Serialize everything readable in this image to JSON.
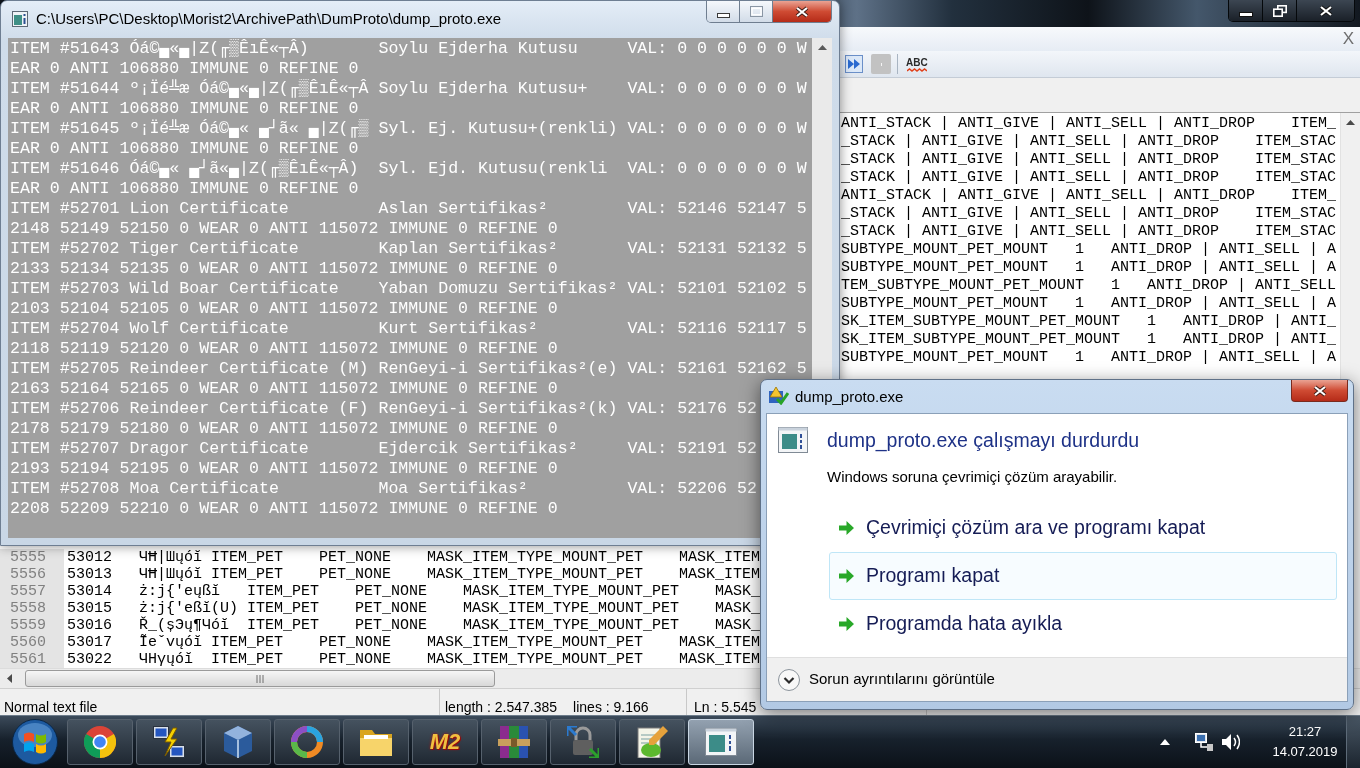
{
  "editor_window": {
    "close_document_label": "X",
    "spellcheck_label": "ABC",
    "visible_text": [
      "ANTI_STACK | ANTI_GIVE | ANTI_SELL | ANTI_DROP    ITEM_",
      "_STACK | ANTI_GIVE | ANTI_SELL | ANTI_DROP    ITEM_STAC",
      "_STACK | ANTI_GIVE | ANTI_SELL | ANTI_DROP    ITEM_STAC",
      "_STACK | ANTI_GIVE | ANTI_SELL | ANTI_DROP    ITEM_STAC",
      "ANTI_STACK | ANTI_GIVE | ANTI_SELL | ANTI_DROP    ITEM_",
      "_STACK | ANTI_GIVE | ANTI_SELL | ANTI_DROP    ITEM_STAC",
      "_STACK | ANTI_GIVE | ANTI_SELL | ANTI_DROP    ITEM_STAC",
      "SUBTYPE_MOUNT_PET_MOUNT   1   ANTI_DROP | ANTI_SELL | A",
      "SUBTYPE_MOUNT_PET_MOUNT   1   ANTI_DROP | ANTI_SELL | A",
      "TEM_SUBTYPE_MOUNT_PET_MOUNT   1   ANTI_DROP | ANTI_SELL",
      "SUBTYPE_MOUNT_PET_MOUNT   1   ANTI_DROP | ANTI_SELL | A",
      "SK_ITEM_SUBTYPE_MOUNT_PET_MOUNT   1   ANTI_DROP | ANTI_",
      "SK_ITEM_SUBTYPE_MOUNT_PET_MOUNT   1   ANTI_DROP | ANTI_",
      "SUBTYPE_MOUNT_PET_MOUNT   1   ANTI_DROP | ANTI_SELL | A"
    ],
    "rows": [
      {
        "line_number": "5555",
        "columns": [
          "53012",
          "ЧĦ|Шųóĭ",
          "ITEM_PET",
          "PET_NONE",
          "MASK_ITEM_TYPE_MOUNT_PET",
          "MASK_ITEM"
        ]
      },
      {
        "line_number": "5556",
        "columns": [
          "53013",
          "ЧĦ|Шųóĭ",
          "ITEM_PET",
          "PET_NONE",
          "MASK_ITEM_TYPE_MOUNT_PET",
          "MASK_ITEM"
        ]
      },
      {
        "line_number": "5557",
        "columns": [
          "53014",
          "ż:j{'eųßĭ",
          "ITEM_PET",
          "PET_NONE",
          "MASK_ITEM_TYPE_MOUNT_PET",
          "MASK_"
        ]
      },
      {
        "line_number": "5558",
        "columns": [
          "53015",
          "ż:j{'eßĭ(U)",
          "ITEM_PET",
          "PET_NONE",
          "MASK_ITEM_TYPE_MOUNT_PET",
          "MASK_"
        ]
      },
      {
        "line_number": "5559",
        "columns": [
          "53016",
          "Ř_(șЭų¶Чóĭ",
          "ITEM_PET",
          "PET_NONE",
          "MASK_ITEM_TYPE_MOUNT_PET",
          "MASK_"
        ]
      },
      {
        "line_number": "5560",
        "columns": [
          "53017",
          "Ĩeˇvųóĭ",
          "ITEM_PET",
          "PET_NONE",
          "MASK_ITEM_TYPE_MOUNT_PET",
          "MASK_ITEM"
        ]
      },
      {
        "line_number": "5561",
        "columns": [
          "53022",
          "ЧHγųóĭ",
          "ITEM_PET",
          "PET_NONE",
          "MASK_ITEM_TYPE_MOUNT_PET",
          "MASK_ITEM"
        ]
      }
    ],
    "status_bar": [
      [
        "Normal text file"
      ],
      [
        "length : 2.547.385",
        "lines : 9.166"
      ],
      [
        "Ln : 5.545"
      ]
    ]
  },
  "console_window": {
    "title": "C:\\Users\\PC\\Desktop\\Morist2\\ArchivePath\\DumProto\\dump_proto.exe",
    "lines": [
      "ITEM #51643 Óá©▄«▄|Z(╓▒ÊıÊ«┬Â)       Soylu Ejderha Kutusu     VAL: 0 0 0 0 0 0 W",
      "EAR 0 ANTI 106880 IMMUNE 0 REFINE 0",
      "ITEM #51644 º¡Ïé╩æ Óá©▄«▄|Z(╓▒ÊıÊ«┬Â Soylu Ejderha Kutusu+    VAL: 0 0 0 0 0 0 W",
      "EAR 0 ANTI 106880 IMMUNE 0 REFINE 0",
      "ITEM #51645 º¡Ïé╩æ Óá©▄« ▄┘ã« ▄|Z(╓▒ Syl. Ej. Kutusu+(renkli) VAL: 0 0 0 0 0 0 W",
      "EAR 0 ANTI 106880 IMMUNE 0 REFINE 0",
      "ITEM #51646 Óá©▄« ▄┘ã«▄|Z(╓▒ÊıÊ«┬Â)  Syl. Ejd. Kutusu(renkli  VAL: 0 0 0 0 0 0 W",
      "EAR 0 ANTI 106880 IMMUNE 0 REFINE 0",
      "ITEM #52701 Lion Certificate         Aslan Sertifikas²        VAL: 52146 52147 5",
      "2148 52149 52150 0 WEAR 0 ANTI 115072 IMMUNE 0 REFINE 0",
      "ITEM #52702 Tiger Certificate        Kaplan Sertifikas²       VAL: 52131 52132 5",
      "2133 52134 52135 0 WEAR 0 ANTI 115072 IMMUNE 0 REFINE 0",
      "ITEM #52703 Wild Boar Certificate    Yaban Domuzu Sertifikas² VAL: 52101 52102 5",
      "2103 52104 52105 0 WEAR 0 ANTI 115072 IMMUNE 0 REFINE 0",
      "ITEM #52704 Wolf Certificate         Kurt Sertifikas²         VAL: 52116 52117 5",
      "2118 52119 52120 0 WEAR 0 ANTI 115072 IMMUNE 0 REFINE 0",
      "ITEM #52705 Reindeer Certificate (M) RenGeyi-i Sertifikas²(e) VAL: 52161 52162 5",
      "2163 52164 52165 0 WEAR 0 ANTI 115072 IMMUNE 0 REFINE 0",
      "ITEM #52706 Reindeer Certificate (F) RenGeyi-i Sertifikas²(k) VAL: 52176 52",
      "2178 52179 52180 0 WEAR 0 ANTI 115072 IMMUNE 0 REFINE 0",
      "ITEM #52707 Dragor Certificate       Ejdercik Sertifikas²     VAL: 52191 52",
      "2193 52194 52195 0 WEAR 0 ANTI 115072 IMMUNE 0 REFINE 0",
      "ITEM #52708 Moa Certificate          Moa Sertifikas²          VAL: 52206 52",
      "2208 52209 52210 0 WEAR 0 ANTI 115072 IMMUNE 0 REFINE 0"
    ]
  },
  "error_dialog": {
    "title": "dump_proto.exe",
    "heading": "dump_proto.exe çalışmayı durdurdu",
    "message": "Windows soruna çevrimiçi çözüm arayabilir.",
    "actions": [
      {
        "label": "Çevrimiçi çözüm ara ve programı kapat",
        "highlighted": false
      },
      {
        "label": "Programı kapat",
        "highlighted": true
      },
      {
        "label": "Programda hata ayıkla",
        "highlighted": false
      }
    ],
    "details_toggle": "Sorun ayrıntılarını görüntüle"
  },
  "taskbar": {
    "buttons": [
      {
        "kind": "browser",
        "selected": false
      },
      {
        "kind": "network",
        "selected": false
      },
      {
        "kind": "cube",
        "selected": false
      },
      {
        "kind": "ring",
        "selected": false
      },
      {
        "kind": "folder",
        "selected": false
      },
      {
        "kind": "game",
        "selected": false,
        "logo_text": "M2"
      },
      {
        "kind": "archive",
        "selected": false
      },
      {
        "kind": "lock",
        "selected": false
      },
      {
        "kind": "notepad",
        "selected": false
      },
      {
        "kind": "console",
        "selected": true
      }
    ],
    "clock": {
      "time": "21:27",
      "date": "14.07.2019"
    }
  }
}
